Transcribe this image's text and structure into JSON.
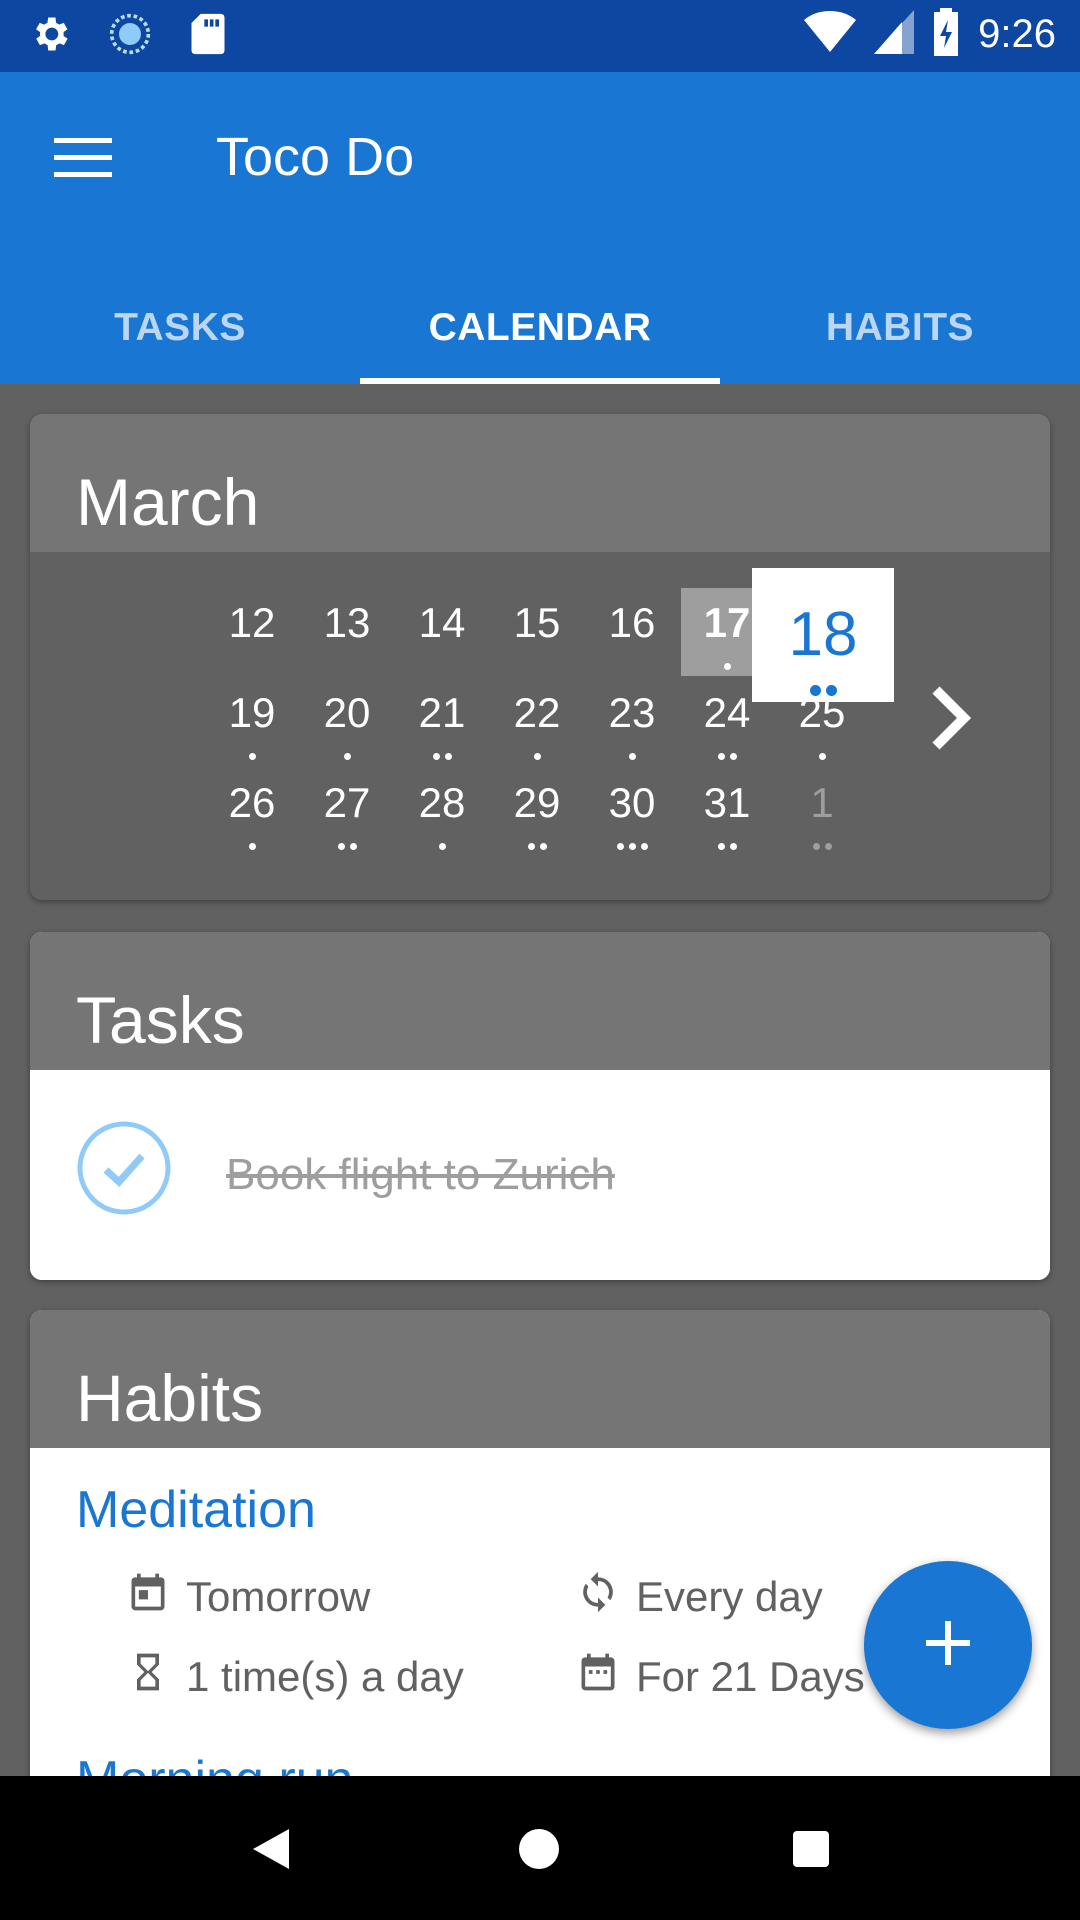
{
  "status_bar": {
    "time": "9:26",
    "left_icons": [
      "settings-icon",
      "sync-icon",
      "sd-card-icon"
    ],
    "right_icons": [
      "wifi-icon",
      "signal-icon",
      "battery-charging-icon"
    ]
  },
  "app_bar": {
    "title": "Toco Do",
    "menu_icon": "hamburger-menu-icon",
    "tabs": [
      {
        "label": "TASKS",
        "active": false
      },
      {
        "label": "CALENDAR",
        "active": true
      },
      {
        "label": "HABITS",
        "active": false
      }
    ]
  },
  "calendar": {
    "month": "March",
    "selected_day": "18",
    "highlighted_day": "17",
    "weeks": [
      [
        {
          "day": "12",
          "dots": 0
        },
        {
          "day": "13",
          "dots": 0
        },
        {
          "day": "14",
          "dots": 0
        },
        {
          "day": "15",
          "dots": 0
        },
        {
          "day": "16",
          "dots": 0
        },
        {
          "day": "17",
          "dots": 1,
          "highlight": true
        },
        {
          "day": "18",
          "dots": 2,
          "selected": true
        }
      ],
      [
        {
          "day": "19",
          "dots": 1
        },
        {
          "day": "20",
          "dots": 1
        },
        {
          "day": "21",
          "dots": 2
        },
        {
          "day": "22",
          "dots": 1
        },
        {
          "day": "23",
          "dots": 1
        },
        {
          "day": "24",
          "dots": 2
        },
        {
          "day": "25",
          "dots": 1
        }
      ],
      [
        {
          "day": "26",
          "dots": 1
        },
        {
          "day": "27",
          "dots": 2
        },
        {
          "day": "28",
          "dots": 1
        },
        {
          "day": "29",
          "dots": 2
        },
        {
          "day": "30",
          "dots": 3
        },
        {
          "day": "31",
          "dots": 2
        },
        {
          "day": "1",
          "dots": 2,
          "muted": true
        }
      ]
    ],
    "next_icon": "chevron-right-icon"
  },
  "tasks": {
    "header": "Tasks",
    "items": [
      {
        "title": "Book flight to Zurich",
        "completed": true
      }
    ]
  },
  "habits": {
    "header": "Habits",
    "items": [
      {
        "name": "Meditation",
        "start": "Tomorrow",
        "repeat": "Every day",
        "frequency": "1 time(s) a day",
        "duration": "For 21 Days"
      },
      {
        "name": "Morning run"
      }
    ]
  },
  "fab": {
    "icon": "plus-icon"
  },
  "colors": {
    "primary": "#1976D2",
    "primary_dark": "#0D47A1",
    "card_header": "#757575",
    "background": "#616161"
  }
}
